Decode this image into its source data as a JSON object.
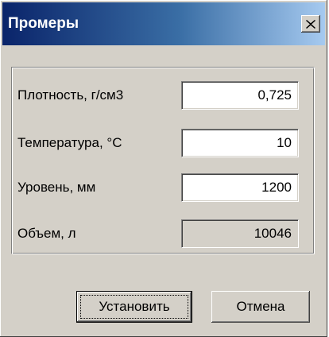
{
  "window": {
    "title": "Промеры",
    "close_symbol": "×",
    "close_icon": "close-icon"
  },
  "fields": [
    {
      "label": "Плотность, г/см3",
      "value": "0,725",
      "readonly": false
    },
    {
      "label": "Температура, °С",
      "value": "10",
      "readonly": false
    },
    {
      "label": "Уровень, мм",
      "value": "1200",
      "readonly": false
    },
    {
      "label": "Объем, л",
      "value": "10046",
      "readonly": true
    }
  ],
  "buttons": {
    "ok_label": "Установить",
    "cancel_label": "Отмена"
  },
  "colors": {
    "face": "#d4d0c8",
    "title_start": "#0a246a",
    "title_end": "#a6caf0"
  }
}
